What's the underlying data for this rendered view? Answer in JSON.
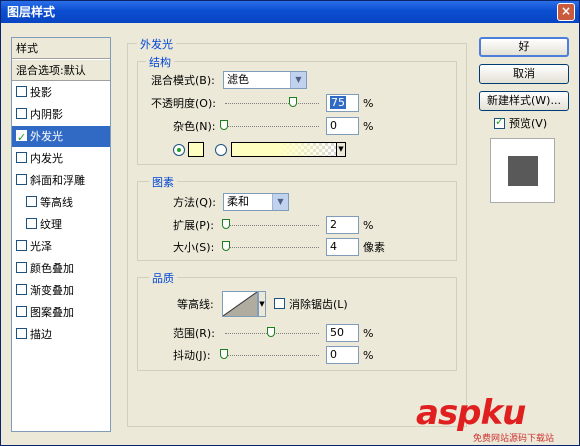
{
  "window": {
    "title": "图层样式",
    "close": "×"
  },
  "sidebar": {
    "items": [
      {
        "label": "样式",
        "type": "header"
      },
      {
        "label": "混合选项:默认",
        "type": "header"
      },
      {
        "label": "投影",
        "checked": false
      },
      {
        "label": "内阴影",
        "checked": false
      },
      {
        "label": "外发光",
        "checked": true,
        "selected": true
      },
      {
        "label": "内发光",
        "checked": false
      },
      {
        "label": "斜面和浮雕",
        "checked": false
      },
      {
        "label": "等高线",
        "checked": false,
        "indent": true
      },
      {
        "label": "纹理",
        "checked": false,
        "indent": true
      },
      {
        "label": "光泽",
        "checked": false
      },
      {
        "label": "颜色叠加",
        "checked": false
      },
      {
        "label": "渐变叠加",
        "checked": false
      },
      {
        "label": "图案叠加",
        "checked": false
      },
      {
        "label": "描边",
        "checked": false
      }
    ]
  },
  "outer_glow": {
    "title": "外发光",
    "structure": {
      "title": "结构",
      "blend_mode_label": "混合模式(B):",
      "blend_mode_value": "滤色",
      "opacity_label": "不透明度(O):",
      "opacity_value": "75",
      "noise_label": "杂色(N):",
      "noise_value": "0",
      "percent": "%",
      "glow_color": "#ffffc0"
    },
    "elements": {
      "title": "图素",
      "method_label": "方法(Q):",
      "method_value": "柔和",
      "spread_label": "扩展(P):",
      "spread_value": "2",
      "size_label": "大小(S):",
      "size_value": "4",
      "px_unit": "像素",
      "percent": "%"
    },
    "quality": {
      "title": "品质",
      "contour_label": "等高线:",
      "antialias_label": "消除锯齿(L)",
      "range_label": "范围(R):",
      "range_value": "50",
      "jitter_label": "抖动(J):",
      "jitter_value": "0",
      "percent": "%"
    }
  },
  "buttons": {
    "ok": "好",
    "cancel": "取消",
    "new_style": "新建样式(W)...",
    "preview_label": "预览(V)"
  },
  "watermark": {
    "logo": "aspku",
    "url": "免费网站源码下载站"
  }
}
